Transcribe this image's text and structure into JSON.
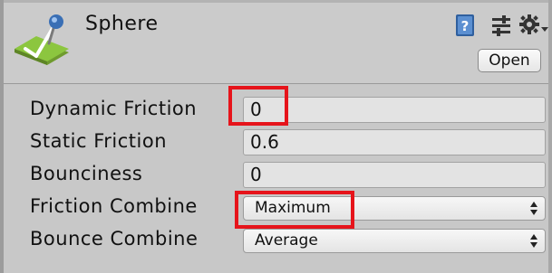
{
  "header": {
    "title": "Sphere",
    "open_label": "Open",
    "icons": [
      "physic-material-icon",
      "help-icon",
      "sliders-icon",
      "gear-icon"
    ]
  },
  "properties": [
    {
      "label": "Dynamic Friction",
      "value": "0",
      "kind": "text"
    },
    {
      "label": "Static Friction",
      "value": "0.6",
      "kind": "text"
    },
    {
      "label": "Bounciness",
      "value": "0",
      "kind": "text"
    },
    {
      "label": "Friction Combine",
      "value": "Maximum",
      "kind": "dropdown"
    },
    {
      "label": "Bounce Combine",
      "value": "Average",
      "kind": "dropdown"
    }
  ],
  "colors": {
    "background": "#c8c8c8",
    "highlight": "#e6141b",
    "icon_green": "#8cc63f",
    "icon_blue": "#3a6fb5"
  }
}
